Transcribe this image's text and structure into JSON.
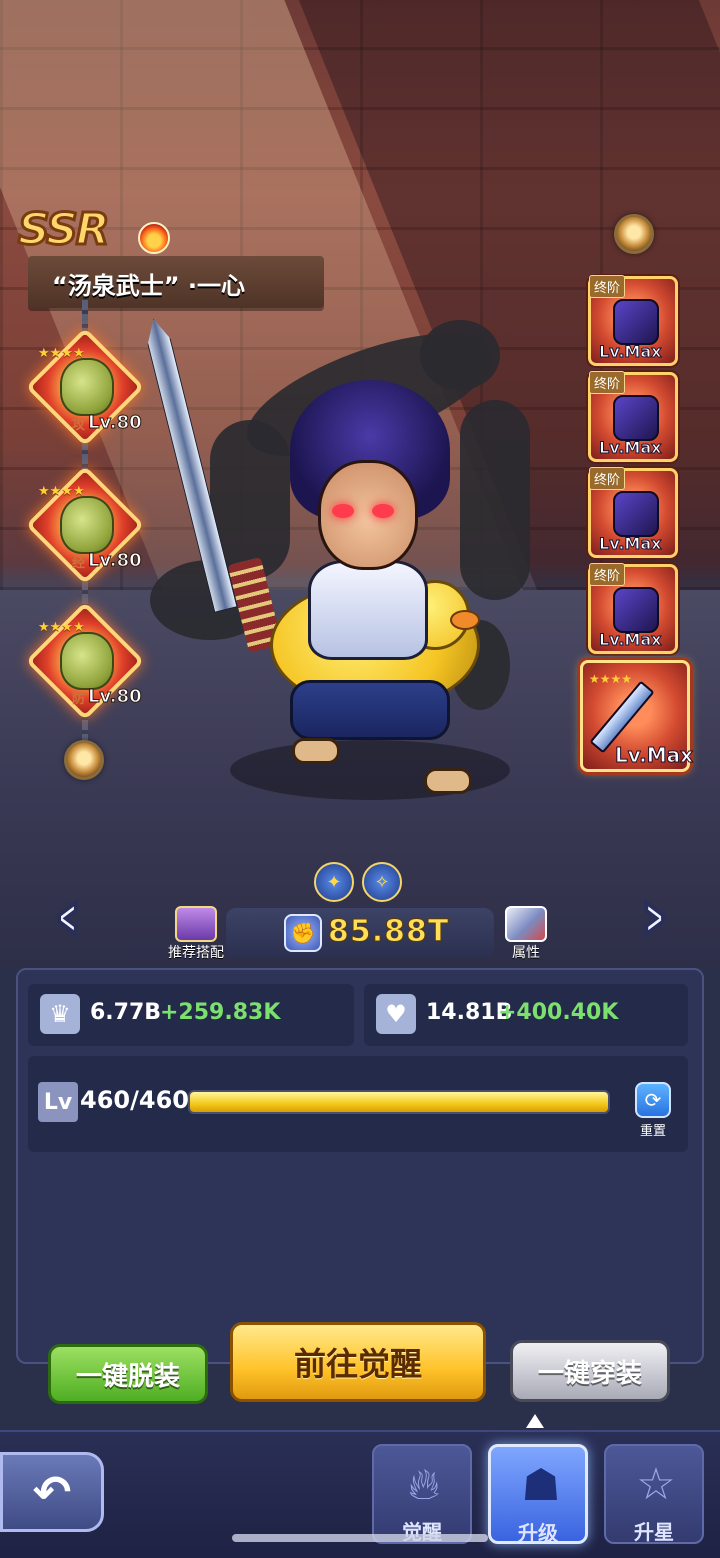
{
  "hero": {
    "rarity": "SSR",
    "name": "“汤泉武士” ·一心"
  },
  "skills": [
    {
      "level": "Lv.80",
      "tag": "攻",
      "stars": "★★★★"
    },
    {
      "level": "Lv.80",
      "tag": "经",
      "stars": "★★★★"
    },
    {
      "level": "Lv.80",
      "tag": "防",
      "stars": "★★★★"
    }
  ],
  "equipment": [
    {
      "tier": "终阶",
      "level": "Lv.Max"
    },
    {
      "tier": "终阶",
      "level": "Lv.Max"
    },
    {
      "tier": "终阶",
      "level": "Lv.Max"
    },
    {
      "tier": "终阶",
      "level": "Lv.Max"
    }
  ],
  "weapon": {
    "level": "Lv.Max",
    "stars": "★★★★"
  },
  "controls": {
    "recommend_label": "推荐搭配",
    "attributes_label": "属性",
    "power": "85.88T"
  },
  "stats": {
    "attack": {
      "value": "6.77B",
      "increase": "+259.83K"
    },
    "hp": {
      "value": "14.81B",
      "increase": "+400.40K"
    }
  },
  "level": {
    "badge": "Lv",
    "text": "460/460",
    "progress": 1.0,
    "reset_label": "重置"
  },
  "actions": {
    "unequip_all": "一键脱装",
    "go_awaken": "前往觉醒",
    "equip_all": "一键穿装"
  },
  "tabs": [
    {
      "label": "觉醒",
      "active": false
    },
    {
      "label": "升级",
      "active": true
    },
    {
      "label": "升星",
      "active": false
    }
  ],
  "colors": {
    "power": "#ffde5a",
    "increase": "#7ce06e",
    "level_fill": "#f4c81a"
  }
}
